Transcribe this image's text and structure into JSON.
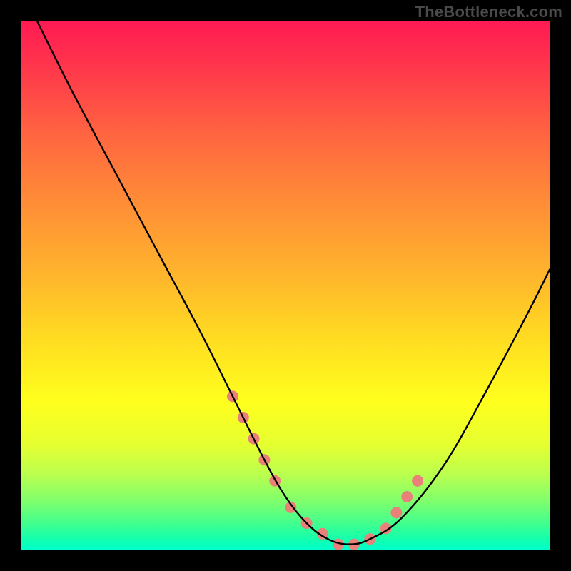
{
  "watermark": "TheBottleneck.com",
  "chart_data": {
    "type": "line",
    "title": "",
    "xlabel": "",
    "ylabel": "",
    "xlim": [
      0,
      100
    ],
    "ylim": [
      0,
      100
    ],
    "grid": false,
    "gradient_colors_top_to_bottom": [
      "#ff1a53",
      "#ff3b4a",
      "#ff6740",
      "#ff8f36",
      "#ffb52c",
      "#ffdc22",
      "#ffff1d",
      "#e6ff30",
      "#b8ff4f",
      "#7dff6e",
      "#42ff8e",
      "#14ffad",
      "#00ffcc"
    ],
    "series": [
      {
        "name": "bottleneck-curve",
        "color": "#000000",
        "x": [
          3,
          10,
          18,
          26,
          34,
          40,
          46,
          50,
          54,
          58,
          62,
          66,
          72,
          80,
          88,
          96,
          100
        ],
        "y": [
          100,
          86,
          71,
          56,
          41,
          29,
          17,
          10,
          5,
          2,
          1,
          2,
          6,
          16,
          30,
          45,
          53
        ]
      }
    ],
    "highlight_points": {
      "name": "highlight-dots",
      "color": "#e9817a",
      "radius_px": 8,
      "x": [
        40,
        42,
        44,
        46,
        48,
        51,
        54,
        57,
        60,
        63,
        66,
        69,
        71,
        73,
        75
      ],
      "y": [
        29,
        25,
        21,
        17,
        13,
        8,
        5,
        3,
        1,
        1,
        2,
        4,
        7,
        10,
        13
      ]
    }
  }
}
